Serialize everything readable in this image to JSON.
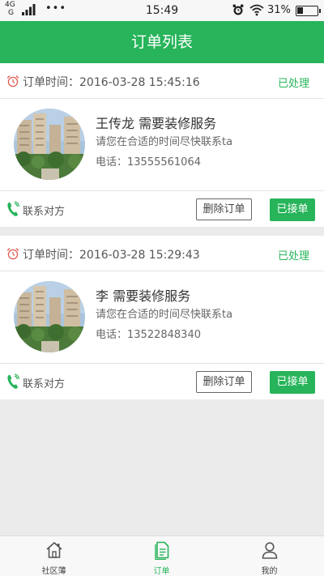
{
  "status_bar": {
    "network_top": "4G",
    "network_bottom": "G",
    "dots": "•••",
    "time": "15:49",
    "battery_text": "31%",
    "battery_level": 0.31
  },
  "header": {
    "title": "订单列表"
  },
  "orders": [
    {
      "time_label": "订单时间：2016-03-28 15:45:16",
      "status": "已处理",
      "title": "王传龙 需要装修服务",
      "description": "请您在合适的时间尽快联系ta",
      "phone_label": "电话：13555561064",
      "contact_label": "联系对方",
      "delete_label": "删除订单",
      "accept_label": "已接单"
    },
    {
      "time_label": "订单时间：2016-03-28 15:29:43",
      "status": "已处理",
      "title": "李 需要装修服务",
      "description": "请您在合适的时间尽快联系ta",
      "phone_label": "电话：13522848340",
      "contact_label": "联系对方",
      "delete_label": "删除订单",
      "accept_label": "已接单"
    }
  ],
  "tab_bar": {
    "items": [
      {
        "label": "社区薄",
        "icon": "home-icon",
        "active": false
      },
      {
        "label": "订单",
        "icon": "order-list-icon",
        "active": true
      },
      {
        "label": "我的",
        "icon": "user-icon",
        "active": false
      }
    ]
  },
  "colors": {
    "accent": "#27b45a",
    "alarm": "#e25a50",
    "background": "#ebebeb"
  }
}
